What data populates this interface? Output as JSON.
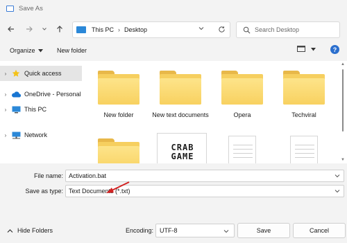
{
  "window": {
    "title": "Save As"
  },
  "navigation": {
    "address_parts": [
      "This PC",
      "Desktop"
    ],
    "search_placeholder": "Search Desktop"
  },
  "toolbar": {
    "organize_label": "Organize",
    "new_folder_label": "New folder"
  },
  "sidebar": {
    "items": [
      {
        "label": "Quick access",
        "icon": "star-icon",
        "selected": true
      },
      {
        "label": "OneDrive - Personal",
        "icon": "cloud-icon",
        "selected": false
      },
      {
        "label": "This PC",
        "icon": "pc-icon",
        "selected": false
      },
      {
        "label": "Network",
        "icon": "network-icon",
        "selected": false
      }
    ]
  },
  "files": {
    "items": [
      {
        "name": "New folder",
        "type": "folder"
      },
      {
        "name": "New text documents",
        "type": "folder"
      },
      {
        "name": "Opera",
        "type": "folder"
      },
      {
        "name": "Techviral",
        "type": "folder"
      },
      {
        "name": "",
        "type": "folder"
      },
      {
        "name": "",
        "type": "image-shortcut",
        "thumb_text": "CRAB GAME"
      },
      {
        "name": "",
        "type": "document"
      },
      {
        "name": "",
        "type": "document"
      }
    ]
  },
  "form": {
    "file_name_label": "File name:",
    "file_name_value": "Activation.bat",
    "save_as_type_label": "Save as type:",
    "save_as_type_value": "Text Documents (*.txt)"
  },
  "footer": {
    "hide_folders_label": "Hide Folders",
    "encoding_label": "Encoding:",
    "encoding_value": "UTF-8",
    "save_label": "Save",
    "cancel_label": "Cancel"
  },
  "colors": {
    "accent": "#2b88d8",
    "folder": "#f6cf5f",
    "annotation_arrow": "#d32222"
  }
}
